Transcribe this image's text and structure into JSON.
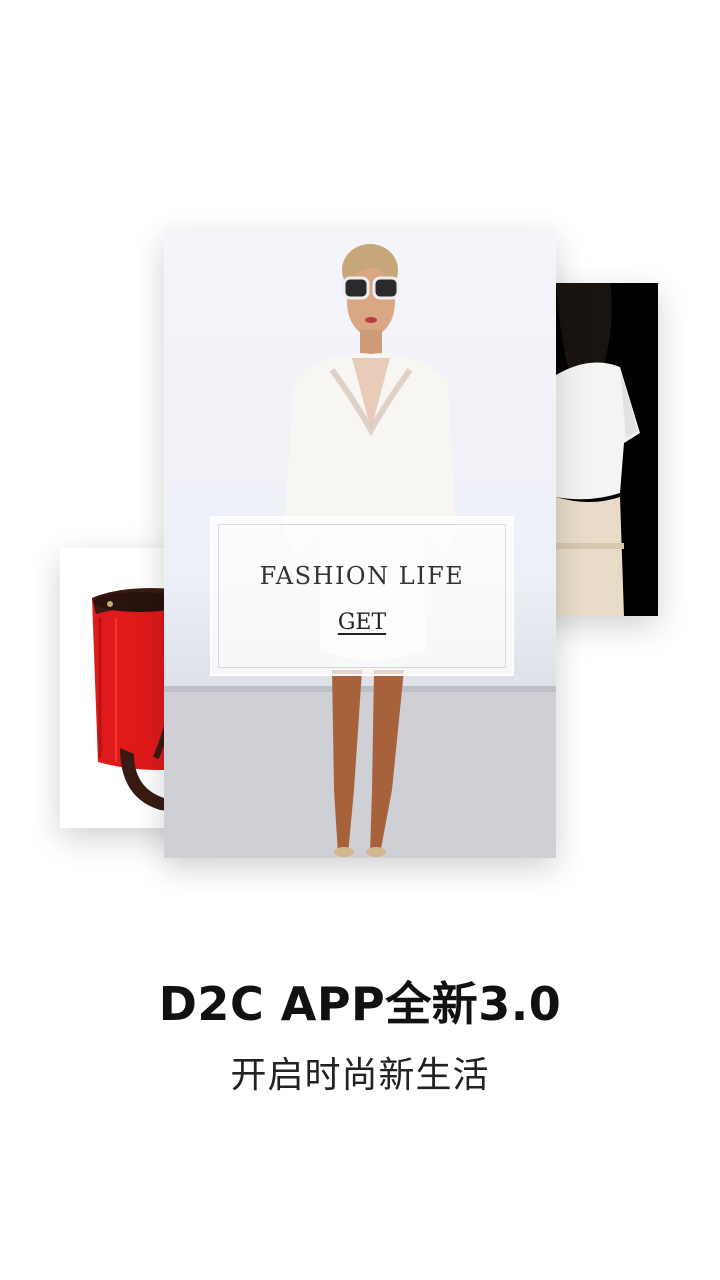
{
  "cards": {
    "main": {
      "overlay_title": "FASHION  LIFE",
      "overlay_link": "GET"
    }
  },
  "headline": "D2C APP全新3.0",
  "subline": "开启时尚新生活",
  "colors": {
    "background": "#ffffff",
    "bag_red": "#e01a1a",
    "strap_dark": "#3a1b14",
    "black_card": "#000000"
  }
}
